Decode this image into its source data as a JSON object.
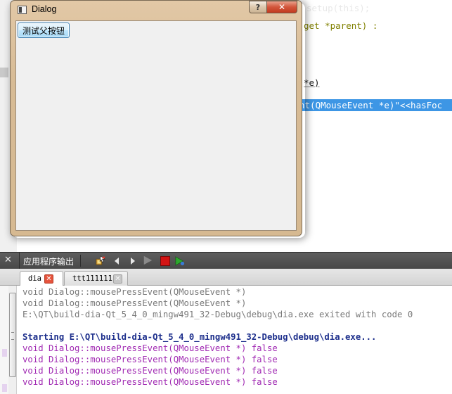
{
  "editor": {
    "lines": [
      {
        "text": "get *parent) :",
        "kind": "normal"
      },
      {
        "text": "*e)",
        "kind": "normal"
      },
      {
        "text": "nt(QMouseEvent *e)\"<<hasFoc",
        "kind": "selected"
      }
    ],
    "ghost_text": "setup(this);"
  },
  "dialog": {
    "title": "Dialog",
    "help_glyph": "?",
    "close_glyph": "✕",
    "test_button_label": "测试父按钮"
  },
  "output_panel": {
    "title": "应用程序输出",
    "close_glyph": "✕",
    "tabs": [
      {
        "label": "dia",
        "active": true
      },
      {
        "label": "ttt111111",
        "active": false
      }
    ],
    "tab_close_glyph": "✕",
    "lines": [
      {
        "text": "void Dialog::mousePressEvent(QMouseEvent *)",
        "style": "grey"
      },
      {
        "text": "void Dialog::mousePressEvent(QMouseEvent *)",
        "style": "grey"
      },
      {
        "text": "E:\\QT\\build-dia-Qt_5_4_0_mingw491_32-Debug\\debug\\dia.exe exited with code 0",
        "style": "grey"
      },
      {
        "text": "",
        "style": "grey"
      },
      {
        "text": "Starting E:\\QT\\build-dia-Qt_5_4_0_mingw491_32-Debug\\debug\\dia.exe...",
        "style": "blue"
      },
      {
        "text": "void Dialog::mousePressEvent(QMouseEvent *) false",
        "style": "purple"
      },
      {
        "text": "void Dialog::mousePressEvent(QMouseEvent *) false",
        "style": "purple"
      },
      {
        "text": "void Dialog::mousePressEvent(QMouseEvent *) false",
        "style": "purple"
      },
      {
        "text": "void Dialog::mousePressEvent(QMouseEvent *) false",
        "style": "purple"
      }
    ]
  },
  "colors": {
    "selection": "#3d96e5",
    "output_grey": "#7a7a7a",
    "output_blue": "#1d2f8c",
    "output_purple": "#a12bb3",
    "stop_red": "#d31414",
    "run_green": "#2da82d"
  },
  "toolbar_icons": [
    "attach-debugger-icon",
    "prev-arrow-icon",
    "next-arrow-icon",
    "run-icon",
    "stop-icon",
    "debug-run-icon"
  ]
}
